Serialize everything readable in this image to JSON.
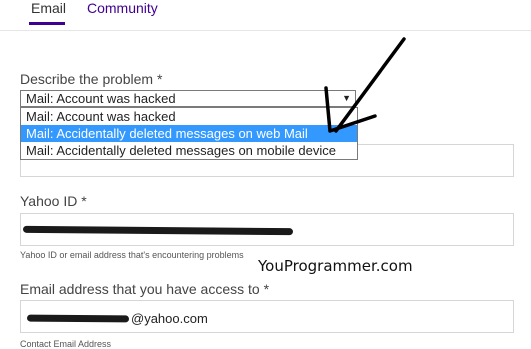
{
  "tabs": {
    "email": "Email",
    "community": "Community"
  },
  "form": {
    "problem_label": "Describe the problem *",
    "problem_selected": "Mail: Account was hacked",
    "problem_options": [
      "Mail: Account was hacked",
      "Mail: Accidentally deleted messages on web Mail",
      "Mail: Accidentally deleted messages on mobile device"
    ],
    "highlighted_option_index": 1,
    "yahoo_id_label": "Yahoo ID *",
    "yahoo_id_hint": "Yahoo ID or email address that's encountering problems",
    "email_label": "Email address that you have access to *",
    "email_value_visible": "@yahoo.com",
    "email_hint": "Contact Email Address"
  },
  "watermark": "YouProgrammer.com",
  "colors": {
    "accent": "#400090",
    "highlight": "#3399ff"
  },
  "icons": {
    "select_arrow": "chevron-down-icon",
    "annotation": "arrow-annotation"
  }
}
